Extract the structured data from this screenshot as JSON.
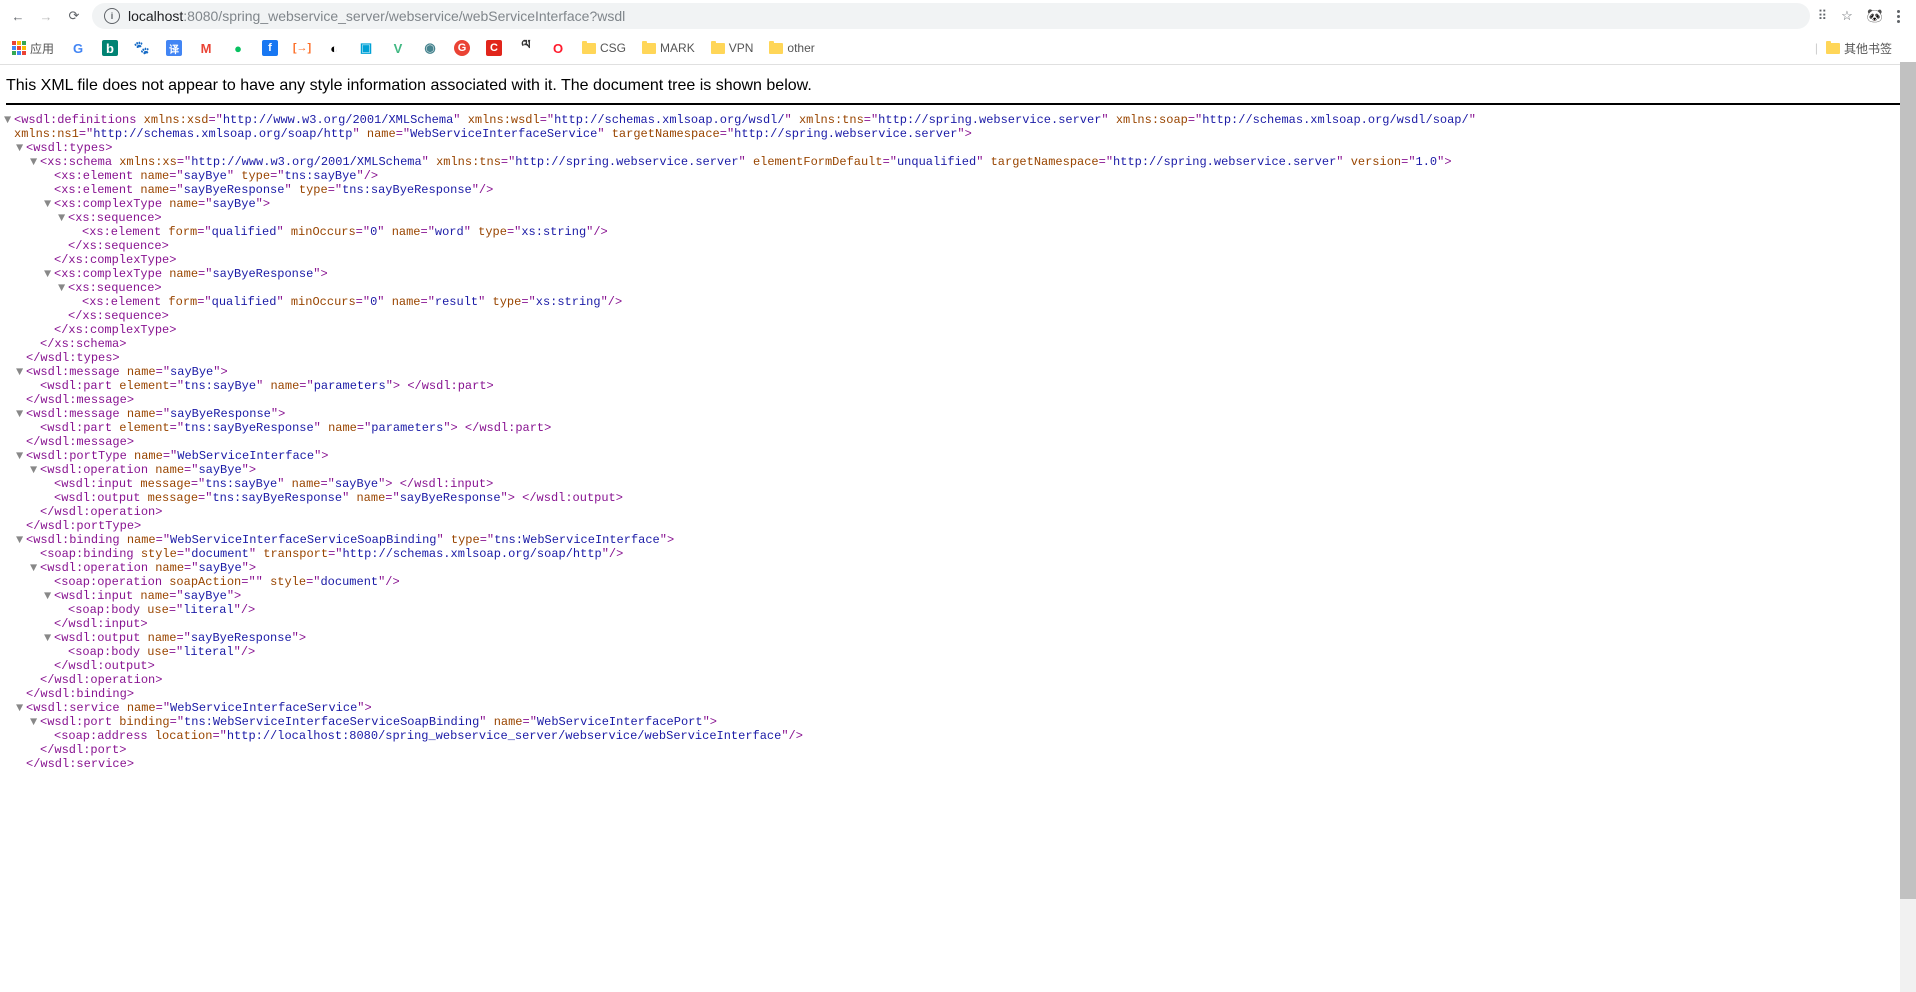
{
  "nav": {
    "url_host_strong": "localhost",
    "url_host_light": ":8080/spring_webservice_server/webservice/webServiceInterface?wsdl"
  },
  "bookmarks": {
    "apps_label": "应用",
    "items": [
      "CSG",
      "MARK",
      "VPN",
      "other"
    ],
    "other": "其他书签"
  },
  "header_msg": "This XML file does not appear to have any style information associated with it. The document tree is shown below.",
  "xml": {
    "l1a": "wsdl:definitions",
    "l1_xmlns_xsd_n": "xmlns:xsd",
    "l1_xmlns_xsd_v": "http://www.w3.org/2001/XMLSchema",
    "l1_xmlns_wsdl_n": "xmlns:wsdl",
    "l1_xmlns_wsdl_v": "http://schemas.xmlsoap.org/wsdl/",
    "l1_xmlns_tns_n": "xmlns:tns",
    "l1_xmlns_tns_v": "http://spring.webservice.server",
    "l1_xmlns_soap_n": "xmlns:soap",
    "l1_xmlns_soap_v": "http://schemas.xmlsoap.org/wsdl/soap/",
    "l1_xmlns_ns1_n": "xmlns:ns1",
    "l1_xmlns_ns1_v": "http://schemas.xmlsoap.org/soap/http",
    "l1_name_n": "name",
    "l1_name_v": "WebServiceInterfaceService",
    "l1_tns_n": "targetNamespace",
    "l1_tns_v": "http://spring.webservice.server",
    "types": "wsdl:types",
    "types_close": "/wsdl:types",
    "schema": "xs:schema",
    "schema_close": "/xs:schema",
    "sch_xmlns_xs_n": "xmlns:xs",
    "sch_xmlns_xs_v": "http://www.w3.org/2001/XMLSchema",
    "sch_xmlns_tns_n": "xmlns:tns",
    "sch_xmlns_tns_v": "http://spring.webservice.server",
    "sch_efd_n": "elementFormDefault",
    "sch_efd_v": "unqualified",
    "sch_tns_n": "targetNamespace",
    "sch_tns_v": "http://spring.webservice.server",
    "sch_ver_n": "version",
    "sch_ver_v": "1.0",
    "el": "xs:element",
    "el_name": "name",
    "el_type": "type",
    "el1_name_v": "sayBye",
    "el1_type_v": "tns:sayBye",
    "el2_name_v": "sayByeResponse",
    "el2_type_v": "tns:sayByeResponse",
    "ct": "xs:complexType",
    "ct_close": "/xs:complexType",
    "ct1_name_v": "sayBye",
    "ct2_name_v": "sayByeResponse",
    "seq": "xs:sequence",
    "seq_close": "/xs:sequence",
    "ie_form_n": "form",
    "ie_form_v": "qualified",
    "ie_min_n": "minOccurs",
    "ie_min_v": "0",
    "ie1_name_v": "word",
    "ie2_name_v": "result",
    "ie_type_v": "xs:string",
    "msg": "wsdl:message",
    "msg_close": "/wsdl:message",
    "msg1_name_v": "sayBye",
    "msg2_name_v": "sayByeResponse",
    "part": "wsdl:part",
    "part_close": "/wsdl:part",
    "part_el_n": "element",
    "part_name_n": "name",
    "part1_el_v": "tns:sayBye",
    "part1_name_v": "parameters",
    "part2_el_v": "tns:sayByeResponse",
    "part2_name_v": "parameters",
    "pt": "wsdl:portType",
    "pt_close": "/wsdl:portType",
    "pt_name_v": "WebServiceInterface",
    "op": "wsdl:operation",
    "op_close": "/wsdl:operation",
    "op_name_v": "sayBye",
    "in": "wsdl:input",
    "in_close": "/wsdl:input",
    "in_msg_n": "message",
    "in_msg_v": "tns:sayBye",
    "in_name_v": "sayBye",
    "out": "wsdl:output",
    "out_close": "/wsdl:output",
    "out_msg_v": "tns:sayByeResponse",
    "out_name_v": "sayByeResponse",
    "bind": "wsdl:binding",
    "bind_close": "/wsdl:binding",
    "bind_name_v": "WebServiceInterfaceServiceSoapBinding",
    "bind_type_n": "type",
    "bind_type_v": "tns:WebServiceInterface",
    "sbind": "soap:binding",
    "sbind_style_n": "style",
    "sbind_style_v": "document",
    "sbind_tr_n": "transport",
    "sbind_tr_v": "http://schemas.xmlsoap.org/soap/http",
    "sop": "soap:operation",
    "sop_sa_n": "soapAction",
    "sop_sa_v": "",
    "sop_style_v": "document",
    "win_name_v": "sayBye",
    "wout_name_v": "sayByeResponse",
    "sbody": "soap:body",
    "sbody_use_n": "use",
    "sbody_use_v": "literal",
    "svc": "wsdl:service",
    "svc_close": "/wsdl:service",
    "svc_name_v": "WebServiceInterfaceService",
    "port": "wsdl:port",
    "port_close": "/wsdl:port",
    "port_bind_n": "binding",
    "port_bind_v": "tns:WebServiceInterfaceServiceSoapBinding",
    "port_name_v": "WebServiceInterfacePort",
    "saddr": "soap:address",
    "saddr_loc_n": "location",
    "saddr_loc_v": "http://localhost:8080/spring_webservice_server/webservice/webServiceInterface"
  }
}
